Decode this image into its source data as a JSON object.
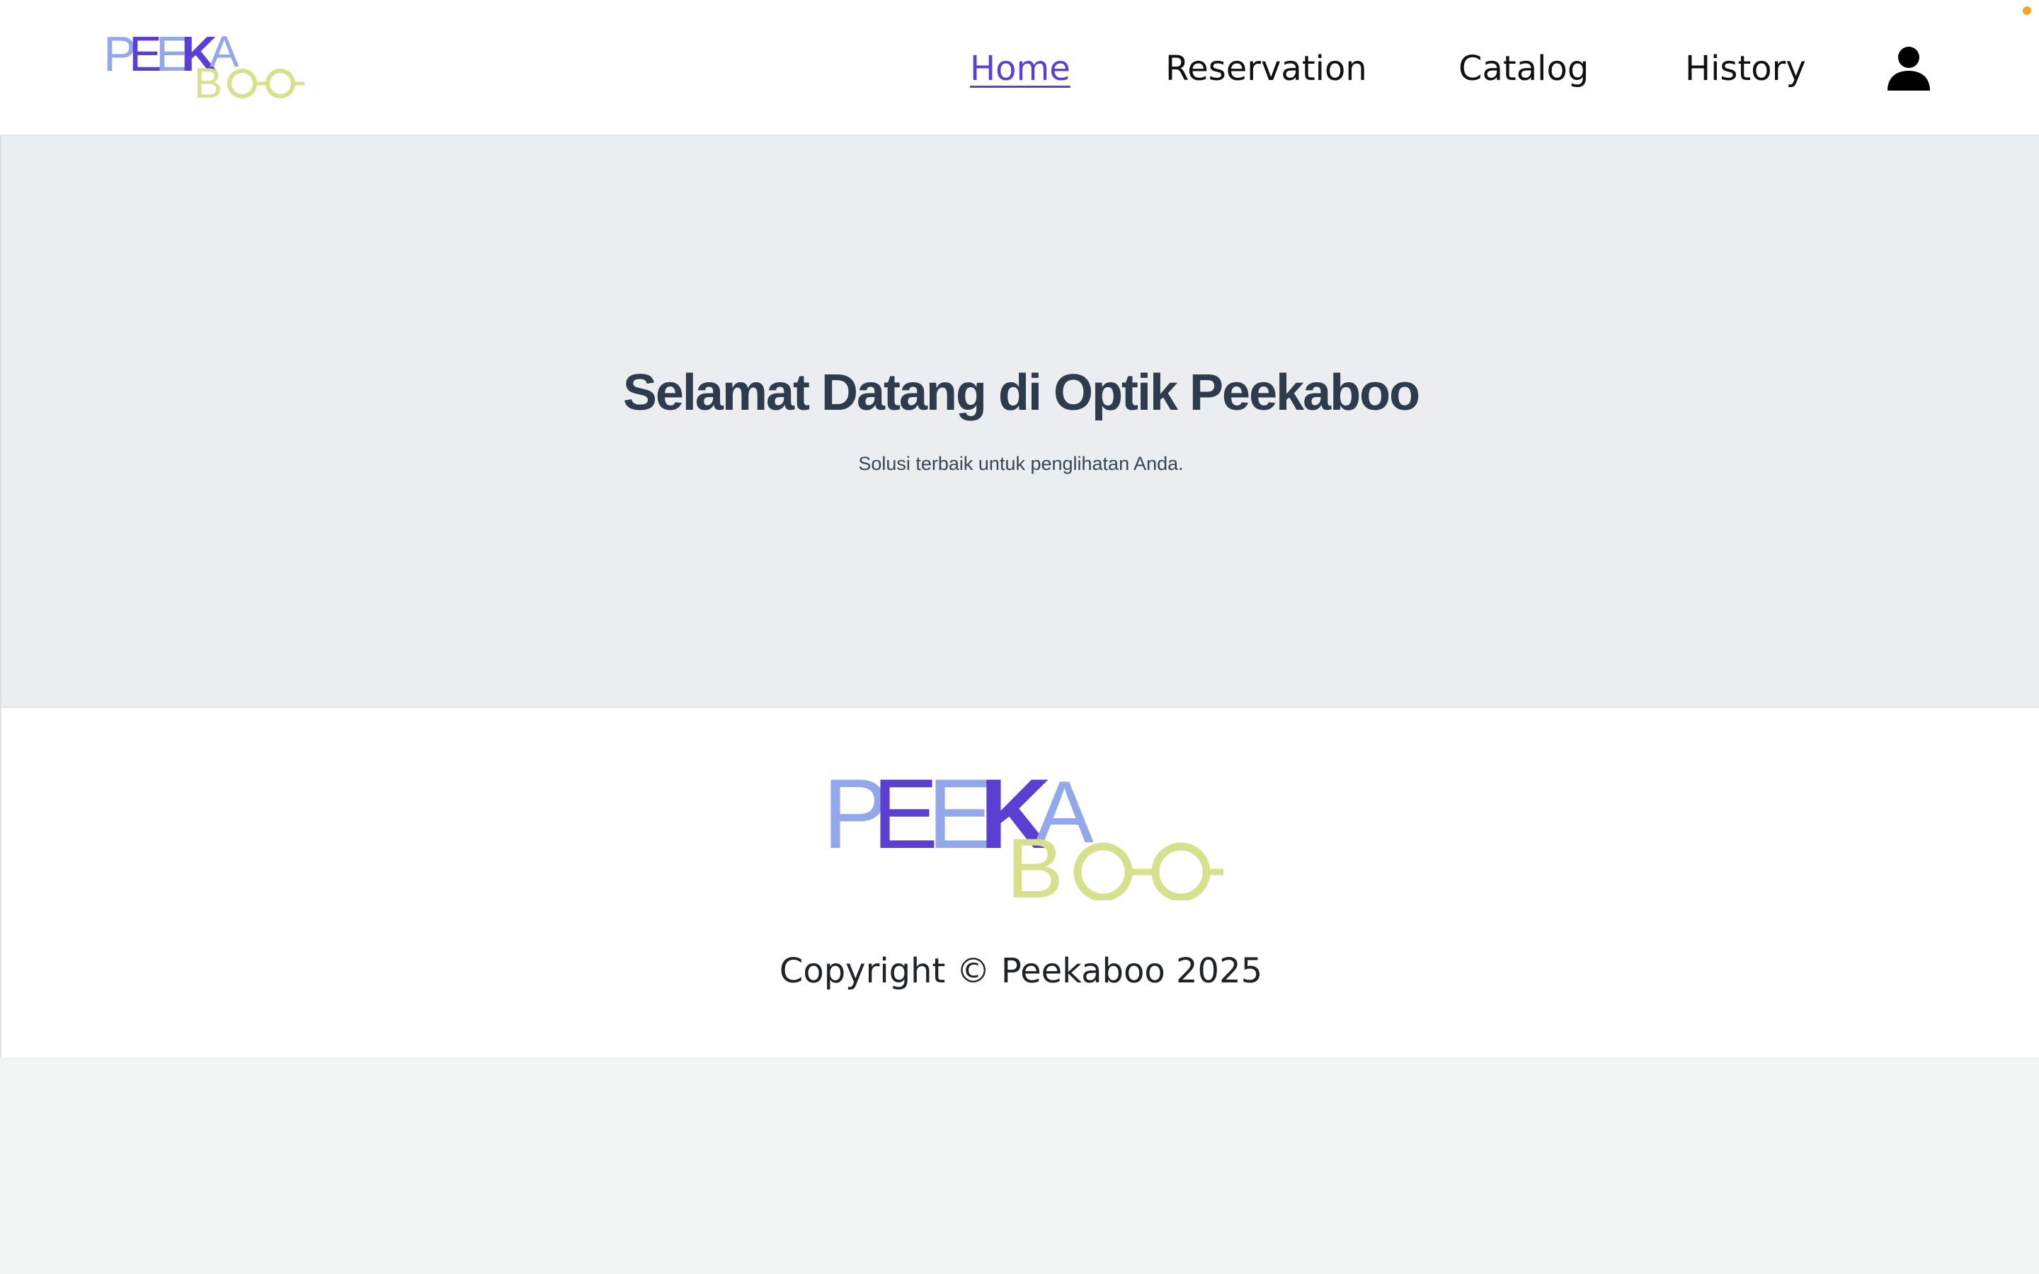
{
  "brand": {
    "name": "PEEKABOO",
    "logo_top": "PEEKA",
    "logo_bottom": "BOO",
    "colors": {
      "light_blue": "#93a8ea",
      "purple": "#5b3fd0",
      "lime": "#d7e08c"
    }
  },
  "nav": {
    "items": [
      {
        "label": "Home",
        "active": true
      },
      {
        "label": "Reservation",
        "active": false
      },
      {
        "label": "Catalog",
        "active": false
      },
      {
        "label": "History",
        "active": false
      }
    ],
    "profile_icon": "user-icon",
    "accent_color": "#5b3fd0"
  },
  "hero": {
    "title": "Selamat Datang di Optik Peekaboo",
    "subtitle": "Solusi terbaik untuk penglihatan Anda."
  },
  "footer": {
    "copyright": "Copyright © Peekaboo 2025"
  }
}
